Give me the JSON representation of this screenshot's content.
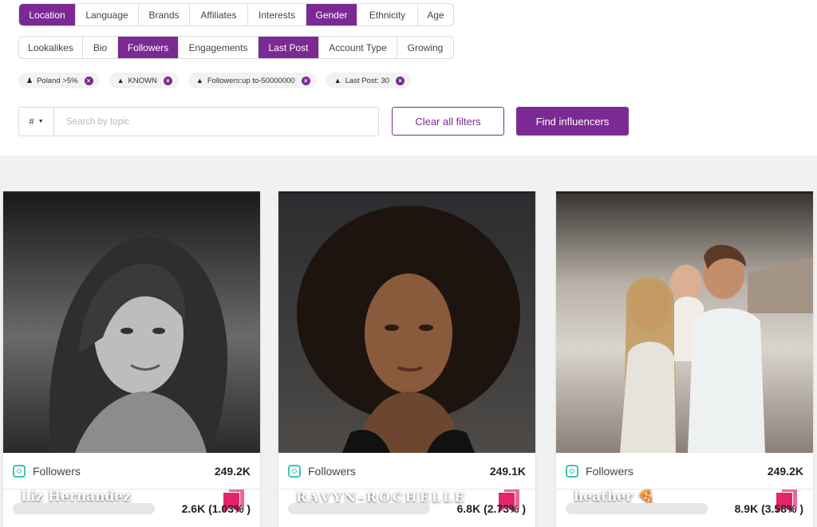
{
  "filters_row1": [
    {
      "label": "Location",
      "active": true
    },
    {
      "label": "Language",
      "active": false
    },
    {
      "label": "Brands",
      "active": false
    },
    {
      "label": "Affiliates",
      "active": false
    },
    {
      "label": "Interests",
      "active": false
    },
    {
      "label": "Gender",
      "active": true
    },
    {
      "label": "Ethnicity",
      "active": false
    },
    {
      "label": "Age",
      "active": false
    }
  ],
  "filters_row2": [
    {
      "label": "Lookalikes",
      "active": false
    },
    {
      "label": "Bio",
      "active": false
    },
    {
      "label": "Followers",
      "active": true
    },
    {
      "label": "Engagements",
      "active": false
    },
    {
      "label": "Last Post",
      "active": true
    },
    {
      "label": "Account Type",
      "active": false
    },
    {
      "label": "Growing",
      "active": false
    }
  ],
  "chips": [
    {
      "label": "Poland >5%",
      "icon": "person-icon"
    },
    {
      "label": "KNOWN",
      "icon": "megaphone-icon"
    },
    {
      "label": "Followers:up to-50000000",
      "icon": "megaphone-icon"
    },
    {
      "label": "Last Post: 30",
      "icon": "megaphone-icon"
    }
  ],
  "search": {
    "prefix": "#",
    "placeholder": "Search by topic",
    "value": ""
  },
  "buttons": {
    "clear": "Clear all filters",
    "find": "Find influencers"
  },
  "colors": {
    "accent": "#7b2a93",
    "instagram": "#3cc4b4",
    "bookmark": "#e5256b"
  },
  "cards": [
    {
      "name": "Liz Hernandez",
      "followers_label": "Followers",
      "followers": "249.2K",
      "engagement": "2.6K (1.03% )",
      "engagement_rate": 0.0103
    },
    {
      "name": "RAVYN-ROCHELLE",
      "followers_label": "Followers",
      "followers": "249.1K",
      "engagement": "6.8K (2.73% )",
      "engagement_rate": 0.0273
    },
    {
      "name": "heather 🍕",
      "followers_label": "Followers",
      "followers": "249.2K",
      "engagement": "8.9K (3.58% )",
      "engagement_rate": 0.0358
    }
  ]
}
